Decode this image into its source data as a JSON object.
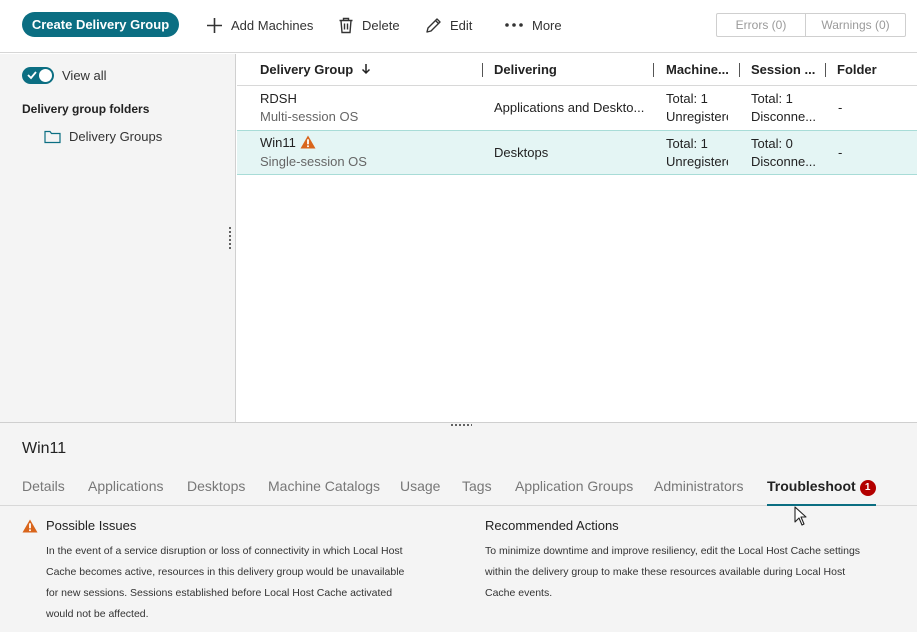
{
  "toolbar": {
    "create_label": "Create Delivery Group",
    "add_machines_label": "Add Machines",
    "delete_label": "Delete",
    "edit_label": "Edit",
    "more_label": "More",
    "errors_label": "Errors (0)",
    "warnings_label": "Warnings (0)"
  },
  "sidebar": {
    "view_all_label": "View all",
    "view_all_on": true,
    "folders_title": "Delivery group folders",
    "folder_label": "Delivery Groups"
  },
  "table": {
    "columns": [
      "Delivery Group",
      "Delivering",
      "Machine...",
      "Session ...",
      "Folder"
    ],
    "sort_column": "Delivery Group",
    "sort_direction": "descending",
    "rows": [
      {
        "name": "RDSH",
        "os": "Multi-session OS",
        "delivering": "Applications and Deskto...",
        "machines_total": "Total: 1",
        "machines_status": "Unregistere",
        "sessions_total": "Total: 1",
        "sessions_status": "Disconne...",
        "folder": "-",
        "warning": false
      },
      {
        "name": "Win11",
        "os": "Single-session OS",
        "delivering": "Desktops",
        "machines_total": "Total: 1",
        "machines_status": "Unregistere",
        "sessions_total": "Total: 0",
        "sessions_status": "Disconne...",
        "folder": "-",
        "warning": true
      }
    ]
  },
  "details": {
    "title": "Win11",
    "tabs": [
      "Details",
      "Applications",
      "Desktops",
      "Machine Catalogs",
      "Usage",
      "Tags",
      "Application Groups",
      "Administrators",
      "Troubleshoot"
    ],
    "active_tab": "Troubleshoot",
    "troubleshoot_badge": "1",
    "issues_title": "Possible Issues",
    "issues_lines": [
      "In the event of a service disruption or loss of connectivity in which Local Host",
      "Cache becomes active, resources in this delivery group would be unavailable",
      "for new sessions. Sessions established before Local Host Cache activated",
      "would not be affected."
    ],
    "actions_title": "Recommended Actions",
    "actions_lines": [
      "To minimize downtime and improve resiliency, edit the Local Host Cache settings",
      "within the delivery group to make these resources available during Local Host",
      "Cache events."
    ]
  },
  "colors": {
    "accent": "#0b6e82",
    "selected_row": "#e4f5f4",
    "warning": "#d9651b",
    "badge": "#b30000"
  }
}
